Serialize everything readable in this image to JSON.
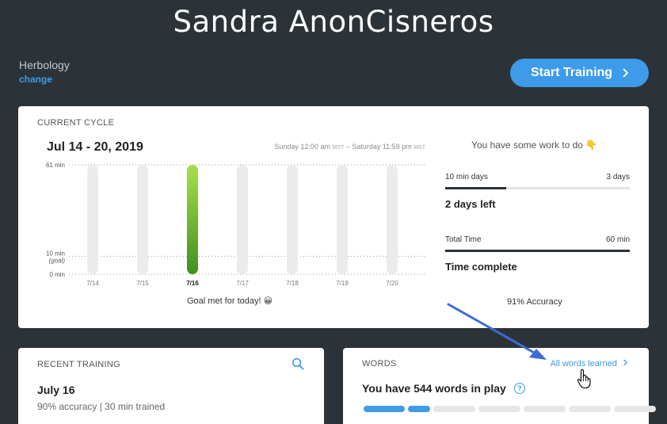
{
  "header": {
    "title": "Sandra AnonCisneros",
    "subject": "Herbology",
    "change_label": "change",
    "start_label": "Start Training"
  },
  "cycle": {
    "label": "CURRENT CYCLE",
    "date_range": "Jul 14 - 20, 2019",
    "start_time": "Sunday 12:00 am",
    "end_time": "Saturday 11:59 pm",
    "tz": "MST",
    "dash": "–",
    "goal_message": "Goal met for today! 😀",
    "work_message": "You have some work to do 👇",
    "stats": {
      "days_label": "10 min days",
      "days_value": "3 days",
      "days_progress": 0.33,
      "days_left": "2 days left",
      "time_label": "Total Time",
      "time_value": "60 min",
      "time_progress": 1.0,
      "time_complete": "Time complete"
    },
    "accuracy": "91% Accuracy"
  },
  "chart_data": {
    "type": "bar",
    "categories": [
      "7/14",
      "7/15",
      "7/16",
      "7/17",
      "7/18",
      "7/19",
      "7/20"
    ],
    "values": [
      0,
      0,
      61,
      0,
      0,
      0,
      0
    ],
    "ylim": [
      0,
      61
    ],
    "yticks": [
      {
        "value": 0,
        "label": "0 min",
        "sub": ""
      },
      {
        "value": 10,
        "label": "10 min",
        "sub": "(goal)"
      },
      {
        "value": 61,
        "label": "61 min",
        "sub": ""
      }
    ],
    "highlight": "7/16",
    "colors": {
      "track": "#ebebeb",
      "fill_top": "#a8e04a",
      "fill_bottom": "#3f8f22"
    }
  },
  "recent": {
    "label": "RECENT TRAINING",
    "date": "July 16",
    "summary": "90% accuracy | 30 min trained"
  },
  "words": {
    "label": "WORDS",
    "all_words_label": "All words learned",
    "count_text": "You have 544 words in play",
    "help": "?",
    "segments": [
      {
        "fill": 1.0
      },
      {
        "fill": 1.0
      },
      {
        "fill": 0
      },
      {
        "fill": 0
      },
      {
        "fill": 0
      },
      {
        "fill": 0
      },
      {
        "fill": 0
      }
    ]
  },
  "colors": {
    "accent": "#3d9be9",
    "background": "#2b3338"
  }
}
